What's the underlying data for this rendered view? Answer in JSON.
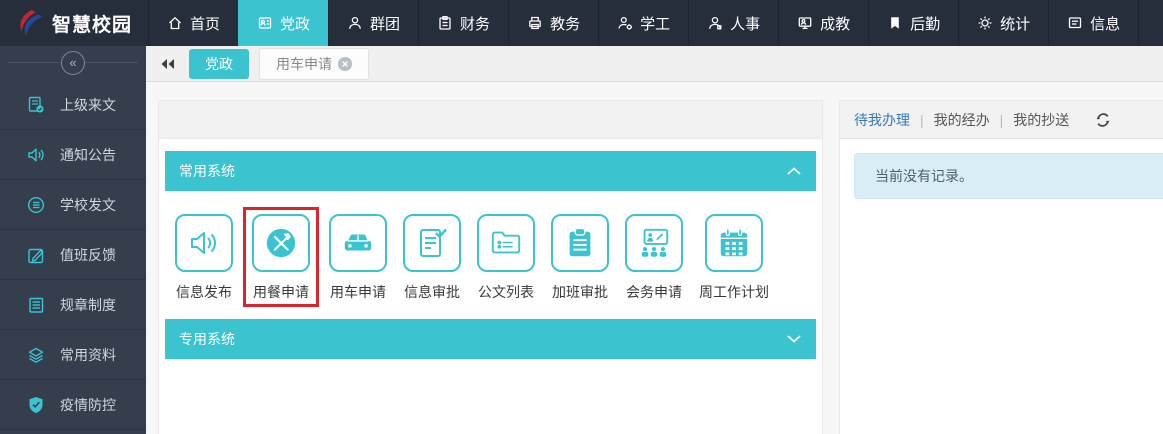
{
  "app": {
    "title": "智慧校园"
  },
  "topnav": {
    "items": [
      {
        "label": "首页",
        "icon": "home-icon",
        "active": false
      },
      {
        "label": "党政",
        "icon": "idcard-icon",
        "active": true
      },
      {
        "label": "群团",
        "icon": "user-icon",
        "active": false
      },
      {
        "label": "财务",
        "icon": "clipboard-icon",
        "active": false
      },
      {
        "label": "教务",
        "icon": "printer-icon",
        "active": false
      },
      {
        "label": "学工",
        "icon": "user-gear-icon",
        "active": false
      },
      {
        "label": "人事",
        "icon": "user-icon",
        "active": false
      },
      {
        "label": "成教",
        "icon": "monitor-user-icon",
        "active": false
      },
      {
        "label": "后勤",
        "icon": "bookmark-icon",
        "active": false
      },
      {
        "label": "统计",
        "icon": "gear-icon",
        "active": false
      },
      {
        "label": "信息",
        "icon": "message-icon",
        "active": false
      }
    ]
  },
  "sidebar": {
    "collapse_icon": "«",
    "items": [
      {
        "label": "上级来文",
        "icon": "document-check-icon"
      },
      {
        "label": "通知公告",
        "icon": "speaker-icon"
      },
      {
        "label": "学校发文",
        "icon": "list-circle-icon"
      },
      {
        "label": "值班反馈",
        "icon": "pencil-square-icon"
      },
      {
        "label": "规章制度",
        "icon": "document-lines-icon"
      },
      {
        "label": "常用资料",
        "icon": "layers-icon"
      },
      {
        "label": "疫情防控",
        "icon": "shield-check-icon"
      }
    ]
  },
  "tabbar": {
    "tabs": [
      {
        "label": "党政",
        "active": true,
        "closable": false
      },
      {
        "label": "用车申请",
        "active": false,
        "closable": true
      }
    ]
  },
  "main": {
    "sections": [
      {
        "title": "常用系统",
        "state": "expanded"
      },
      {
        "title": "专用系统",
        "state": "collapsed"
      }
    ],
    "apps": [
      {
        "label": "信息发布",
        "icon": "speaker-icon",
        "highlighted": false
      },
      {
        "label": "用餐申请",
        "icon": "meal-icon",
        "highlighted": true
      },
      {
        "label": "用车申请",
        "icon": "car-icon",
        "highlighted": false
      },
      {
        "label": "信息审批",
        "icon": "document-check-icon",
        "highlighted": false
      },
      {
        "label": "公文列表",
        "icon": "folder-list-icon",
        "highlighted": false
      },
      {
        "label": "加班审批",
        "icon": "clipboard-icon",
        "highlighted": false
      },
      {
        "label": "会务申请",
        "icon": "meeting-icon",
        "highlighted": false
      },
      {
        "label": "周工作计划",
        "icon": "calendar-icon",
        "highlighted": false
      }
    ]
  },
  "right_panel": {
    "separator": "|",
    "tabs": [
      {
        "label": "待我办理",
        "active": true
      },
      {
        "label": "我的经办",
        "active": false
      },
      {
        "label": "我的抄送",
        "active": false
      }
    ],
    "empty_message": "当前没有记录。"
  },
  "colors": {
    "accent_teal": "#3bc4cf",
    "nav_bg": "#262e3c",
    "sidebar_bg": "#343e4d",
    "highlight_red": "#d9252b",
    "link_blue": "#337ab7",
    "info_box_bg": "#d9edf7"
  }
}
